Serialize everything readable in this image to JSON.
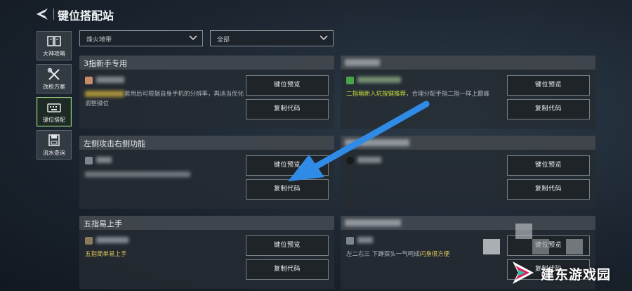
{
  "header": {
    "title": "键位搭配站"
  },
  "sidebar": {
    "items": [
      {
        "label": "大神攻略",
        "icon": "book-icon"
      },
      {
        "label": "改枪方案",
        "icon": "tools-icon"
      },
      {
        "label": "键位搭配",
        "icon": "keyboard-icon",
        "active": true
      },
      {
        "label": "流水查询",
        "icon": "save-icon"
      }
    ]
  },
  "filters": {
    "map": "烽火地带",
    "category": "全部"
  },
  "buttons": {
    "preview": "键位预览",
    "copy": "复制代码"
  },
  "cards": [
    {
      "title": "3指新手专用",
      "author": "",
      "desc_part1": "",
      "desc_part2": "套用后可根据自身手机的分辨率，再适当优化调整键位"
    },
    {
      "title": "",
      "author": "",
      "desc_part1": "二指萌新入坑按键推荐",
      "desc_part2": "，合理分配手指二指一样上巅峰"
    },
    {
      "title": "左侧攻击右侧功能",
      "author": "",
      "desc_part1": "",
      "desc_part2": ""
    },
    {
      "title": "",
      "author": "",
      "desc_part1": "",
      "desc_part2": ""
    },
    {
      "title": "五指易上手",
      "author": "",
      "desc_part1": "五指简单易上手",
      "desc_part2": ""
    },
    {
      "title": "",
      "author": "",
      "desc_part1": "左二右三 下蹲探头一气呵成",
      "desc_part2": "闪身很方便"
    }
  ],
  "watermark": {
    "text": "建东游戏园"
  },
  "colors": {
    "accent_green": "#9fd08a",
    "highlight_yellow": "#e2c85c",
    "arrow_blue": "#2f8be6"
  }
}
